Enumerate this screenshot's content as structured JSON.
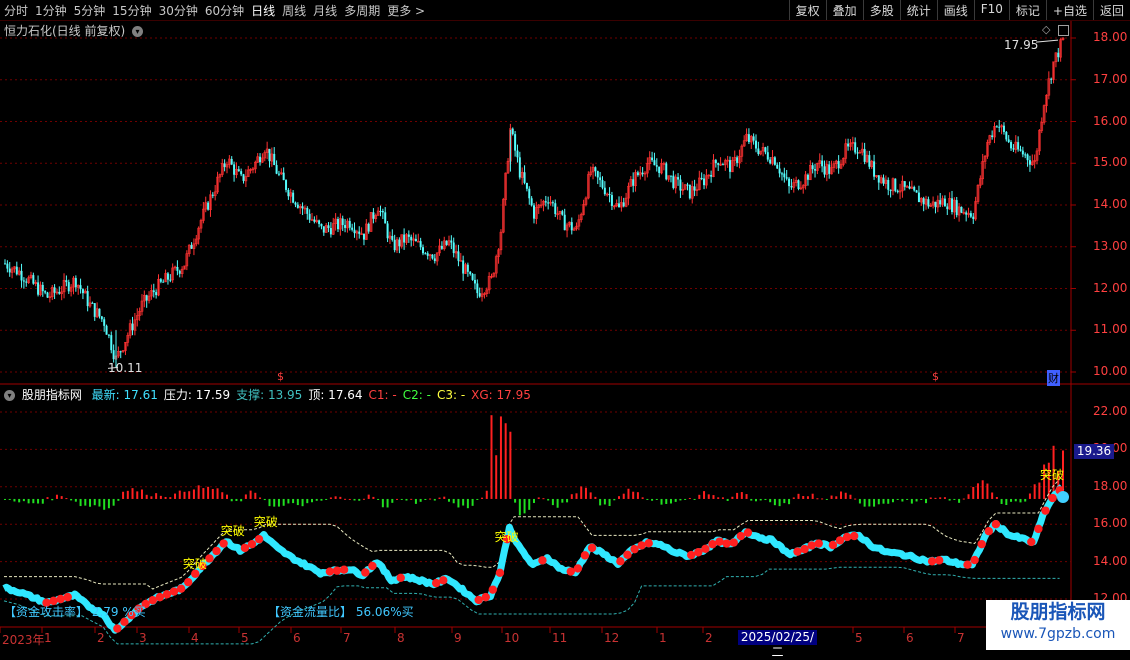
{
  "toolbar": {
    "periods": [
      "分时",
      "1分钟",
      "5分钟",
      "15分钟",
      "30分钟",
      "60分钟",
      "日线",
      "周线",
      "月线",
      "多周期",
      "更多 >"
    ],
    "active_period": "日线",
    "tools": [
      "复权",
      "叠加",
      "多股",
      "统计",
      "画线",
      "F10",
      "标记",
      "+自选",
      "返回"
    ]
  },
  "main_chart": {
    "title": "恒力石化(日线 前复权)",
    "y_ticks": [
      "18.00",
      "17.00",
      "16.00",
      "15.00",
      "14.00",
      "13.00",
      "12.00",
      "11.00",
      "10.00"
    ],
    "low_label": "10.11",
    "high_label": "17.95",
    "markers": [
      "$",
      "$",
      "财"
    ]
  },
  "indicator": {
    "name": "股朋指标网",
    "fields": [
      {
        "label": "最新:",
        "value": "17.61",
        "color": "#40e0ff"
      },
      {
        "label": "压力:",
        "value": "17.59",
        "color": "#ffffff"
      },
      {
        "label": "支撑:",
        "value": "13.95",
        "color": "#40c0c0"
      },
      {
        "label": "顶:",
        "value": "17.64",
        "color": "#ffffff"
      },
      {
        "label": "C1:",
        "value": "-",
        "color": "#ff4040"
      },
      {
        "label": "C2:",
        "value": "-",
        "color": "#40ff40"
      },
      {
        "label": "C3:",
        "value": "-",
        "color": "#ffff40"
      },
      {
        "label": "XG:",
        "value": "17.95",
        "color": "#ff4040"
      }
    ],
    "y_ticks": [
      "22.00",
      "20.00",
      "18.00",
      "16.00",
      "14.00",
      "12.00"
    ],
    "current_value": "19.36",
    "breakout_label": "突破",
    "attack_label": "【资金攻击率】",
    "attack_value": "2.79 %买",
    "flow_label": "【资金流量比】",
    "flow_value": "56.06%买"
  },
  "x_axis": {
    "labels": [
      "2023年",
      "1",
      "2",
      "3",
      "4",
      "5",
      "6",
      "7",
      "8",
      "9",
      "10",
      "11",
      "12",
      "1",
      "2",
      "5",
      "6",
      "7"
    ],
    "selected_date": "2025/02/25/二"
  },
  "watermark": {
    "name": "股朋指标网",
    "url": "www.7gpzb.com"
  },
  "chart_data": {
    "type": "candlestick",
    "price_path": [
      {
        "t": 0,
        "p": 12.6
      },
      {
        "t": 6,
        "p": 12.4
      },
      {
        "t": 12,
        "p": 12.1
      },
      {
        "t": 18,
        "p": 11.8
      },
      {
        "t": 24,
        "p": 12.0
      },
      {
        "t": 30,
        "p": 12.2
      },
      {
        "t": 36,
        "p": 11.6
      },
      {
        "t": 42,
        "p": 11.2
      },
      {
        "t": 47,
        "p": 10.3
      },
      {
        "t": 52,
        "p": 10.9
      },
      {
        "t": 58,
        "p": 11.6
      },
      {
        "t": 64,
        "p": 12.0
      },
      {
        "t": 70,
        "p": 12.3
      },
      {
        "t": 76,
        "p": 12.6
      },
      {
        "t": 82,
        "p": 13.5
      },
      {
        "t": 88,
        "p": 14.3
      },
      {
        "t": 94,
        "p": 15.1
      },
      {
        "t": 100,
        "p": 14.6
      },
      {
        "t": 106,
        "p": 15.0
      },
      {
        "t": 110,
        "p": 15.4
      },
      {
        "t": 116,
        "p": 14.7
      },
      {
        "t": 122,
        "p": 14.2
      },
      {
        "t": 128,
        "p": 13.8
      },
      {
        "t": 134,
        "p": 13.4
      },
      {
        "t": 140,
        "p": 13.5
      },
      {
        "t": 146,
        "p": 13.6
      },
      {
        "t": 152,
        "p": 13.3
      },
      {
        "t": 158,
        "p": 14.0
      },
      {
        "t": 164,
        "p": 13.0
      },
      {
        "t": 170,
        "p": 13.2
      },
      {
        "t": 176,
        "p": 13.0
      },
      {
        "t": 182,
        "p": 12.8
      },
      {
        "t": 188,
        "p": 13.1
      },
      {
        "t": 194,
        "p": 12.5
      },
      {
        "t": 200,
        "p": 11.9
      },
      {
        "t": 206,
        "p": 12.2
      },
      {
        "t": 210,
        "p": 13.4
      },
      {
        "t": 214,
        "p": 15.8
      },
      {
        "t": 218,
        "p": 14.8
      },
      {
        "t": 224,
        "p": 13.8
      },
      {
        "t": 230,
        "p": 14.2
      },
      {
        "t": 236,
        "p": 13.6
      },
      {
        "t": 242,
        "p": 13.4
      },
      {
        "t": 248,
        "p": 14.8
      },
      {
        "t": 254,
        "p": 14.4
      },
      {
        "t": 260,
        "p": 13.9
      },
      {
        "t": 266,
        "p": 14.6
      },
      {
        "t": 272,
        "p": 15.0
      },
      {
        "t": 278,
        "p": 14.9
      },
      {
        "t": 284,
        "p": 14.5
      },
      {
        "t": 290,
        "p": 14.3
      },
      {
        "t": 296,
        "p": 14.6
      },
      {
        "t": 302,
        "p": 15.1
      },
      {
        "t": 308,
        "p": 14.9
      },
      {
        "t": 314,
        "p": 15.6
      },
      {
        "t": 320,
        "p": 15.3
      },
      {
        "t": 326,
        "p": 15.1
      },
      {
        "t": 332,
        "p": 14.4
      },
      {
        "t": 338,
        "p": 14.6
      },
      {
        "t": 344,
        "p": 15.0
      },
      {
        "t": 350,
        "p": 14.8
      },
      {
        "t": 356,
        "p": 15.3
      },
      {
        "t": 362,
        "p": 15.4
      },
      {
        "t": 368,
        "p": 14.8
      },
      {
        "t": 374,
        "p": 14.5
      },
      {
        "t": 380,
        "p": 14.4
      },
      {
        "t": 386,
        "p": 14.2
      },
      {
        "t": 392,
        "p": 14.0
      },
      {
        "t": 398,
        "p": 14.1
      },
      {
        "t": 404,
        "p": 13.9
      },
      {
        "t": 410,
        "p": 13.8
      },
      {
        "t": 416,
        "p": 15.5
      },
      {
        "t": 420,
        "p": 16.0
      },
      {
        "t": 426,
        "p": 15.4
      },
      {
        "t": 432,
        "p": 15.2
      },
      {
        "t": 436,
        "p": 15.0
      },
      {
        "t": 440,
        "p": 16.5
      },
      {
        "t": 444,
        "p": 17.4
      },
      {
        "t": 448,
        "p": 17.95
      }
    ],
    "y_range": [
      10.0,
      18.2
    ],
    "indicator_range": [
      11.0,
      23.0
    ],
    "breakout_t": [
      80,
      96,
      110,
      212,
      448
    ],
    "y_unit": "price"
  },
  "colors": {
    "up": "#ff3232",
    "down": "#54fcfc",
    "grid": "#800000",
    "axis_text": "#ff4040",
    "bar_up": "#ff2020",
    "bar_down": "#20e020"
  }
}
